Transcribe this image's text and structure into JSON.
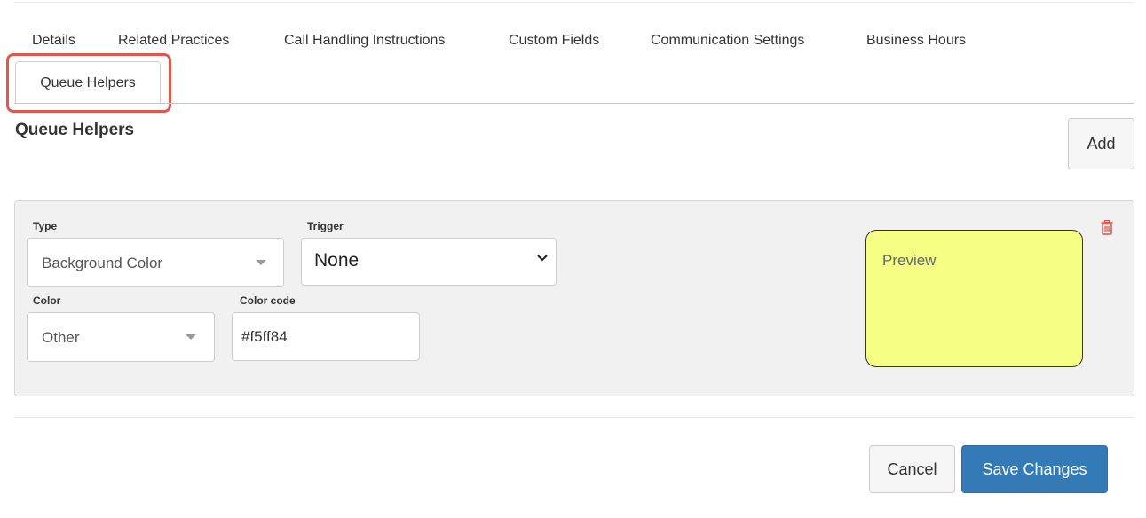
{
  "tabs": {
    "details": "Details",
    "related_practices": "Related Practices",
    "call_handling": "Call Handling Instructions",
    "custom_fields": "Custom Fields",
    "communication_settings": "Communication Settings",
    "business_hours": "Business Hours",
    "queue_helpers": "Queue Helpers"
  },
  "section": {
    "title": "Queue Helpers",
    "add_label": "Add"
  },
  "helper": {
    "type_label": "Type",
    "type_value": "Background Color",
    "trigger_label": "Trigger",
    "trigger_value": "None",
    "color_label": "Color",
    "color_value": "Other",
    "color_code_label": "Color code",
    "color_code_value": "#f5ff84",
    "preview_label": "Preview",
    "preview_color": "#f5ff84",
    "delete_icon": "trash-icon"
  },
  "footer": {
    "cancel_label": "Cancel",
    "save_label": "Save Changes"
  },
  "colors": {
    "primary": "#337ab7",
    "highlight": "#e2574c",
    "danger_icon": "#d9534f"
  }
}
